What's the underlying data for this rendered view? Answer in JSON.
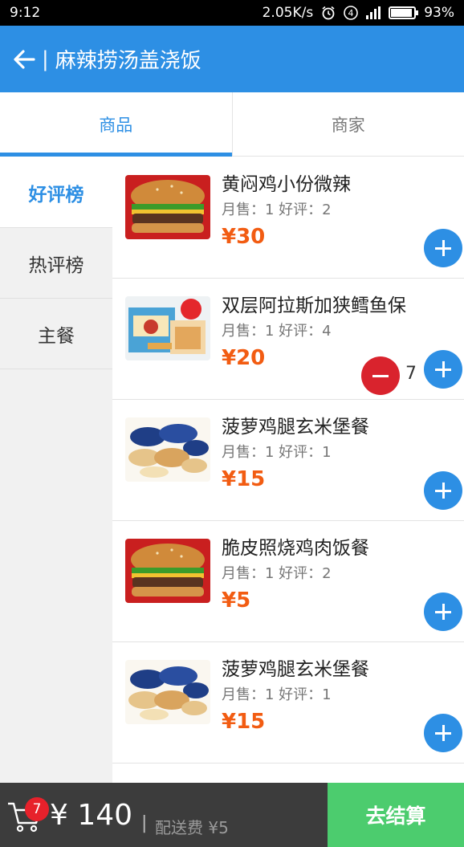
{
  "status_bar": {
    "time": "9:12",
    "speed": "2.05K/s",
    "battery": "93%",
    "battery_level": 0.93
  },
  "header": {
    "separator": "|",
    "title": "麻辣捞汤盖浇饭"
  },
  "tabs": [
    {
      "label": "商品",
      "active": true
    },
    {
      "label": "商家",
      "active": false
    }
  ],
  "categories": [
    {
      "label": "好评榜",
      "active": true
    },
    {
      "label": "热评榜",
      "active": false
    },
    {
      "label": "主餐",
      "active": false
    }
  ],
  "products": [
    {
      "name": "黄闷鸡小份微辣",
      "stats": "月售：1 好评：2",
      "price": "¥30",
      "image": "burger"
    },
    {
      "name": "双层阿拉斯加狭鳕鱼保",
      "stats": "月售：1 好评：4",
      "price": "¥20",
      "image": "snack-box",
      "quantity": "7"
    },
    {
      "name": "菠萝鸡腿玄米堡餐",
      "stats": "月售：1 好评：1",
      "price": "¥15",
      "image": "cookie-tins"
    },
    {
      "name": "脆皮照烧鸡肉饭餐",
      "stats": "月售：1 好评：2",
      "price": "¥5",
      "image": "burger"
    },
    {
      "name": "菠萝鸡腿玄米堡餐",
      "stats": "月售：1 好评：1",
      "price": "¥15",
      "image": "cookie-tins"
    }
  ],
  "cart": {
    "badge": "7",
    "total": "¥ 140",
    "separator": "|",
    "delivery": "配送费 ¥5",
    "checkout_label": "去结算"
  },
  "colors": {
    "primary": "#2d8fe4",
    "price": "#f25c12",
    "minus": "#d9232d",
    "checkout": "#4ccc6e",
    "bottom_bar": "#3c3c3c"
  },
  "icons": {
    "back": "arrow-left-icon",
    "cart": "cart-icon",
    "add": "plus-icon",
    "remove": "minus-icon"
  }
}
